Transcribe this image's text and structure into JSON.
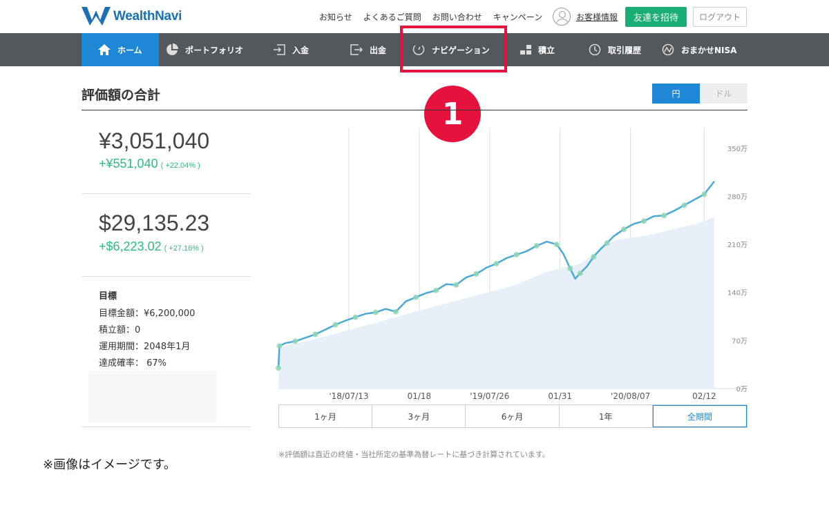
{
  "header": {
    "brand": "WealthNavi",
    "links": [
      "お知らせ",
      "よくあるご質問",
      "お問い合わせ",
      "キャンペーン"
    ],
    "account_label": "お客様情報",
    "invite_label": "友達を招待",
    "logout_label": "ログアウト"
  },
  "nav": {
    "items": [
      {
        "label": "ホーム",
        "icon": "home-icon",
        "active": true
      },
      {
        "label": "ポートフォリオ",
        "icon": "pie-chart-icon"
      },
      {
        "label": "入金",
        "icon": "deposit-icon"
      },
      {
        "label": "出金",
        "icon": "withdraw-icon"
      },
      {
        "label": "ナビゲーション",
        "icon": "gauge-icon"
      },
      {
        "label": "積立",
        "icon": "stack-icon"
      },
      {
        "label": "取引履歴",
        "icon": "history-icon"
      },
      {
        "label": "おまかせNISA",
        "icon": "nisa-icon"
      }
    ]
  },
  "annotation": {
    "step_number": "1",
    "highlight_color": "#e6123d"
  },
  "main": {
    "title": "評価額の合計",
    "currency_toggle": {
      "yen": "円",
      "dollar": "ドル",
      "selected": "円"
    },
    "summary": {
      "yen_total": "¥3,051,040",
      "yen_gain": "+¥551,040",
      "yen_gain_pct": "( +22.04% )",
      "usd_total": "$29,135.23",
      "usd_gain": "+$6,223.02",
      "usd_gain_pct": "( +27.16% )",
      "goal_heading": "目標",
      "goal_amount": "目標金額：¥6,200,000",
      "monthly": "積立額：0",
      "period": "運用期間：2048年1月",
      "probability": "達成確率：  67%"
    },
    "periods": [
      "1ヶ月",
      "3ヶ月",
      "6ヶ月",
      "1年",
      "全期間"
    ],
    "period_selected": "全期間",
    "note": "※評価額は直近の終値・当社所定の基準為替レートに基づき計算されています。"
  },
  "caption": "※画像はイメージです。",
  "colors": {
    "accent": "#1e87d6",
    "positive": "#2dbb7c",
    "nav_bg": "#53585c",
    "line": "#4aa8d8",
    "area": "#e7f0f9"
  },
  "chart_data": {
    "type": "line",
    "x_ticks": [
      "'18/07/13",
      "01/18",
      "'19/07/26",
      "01/31",
      "'20/08/07",
      "02/12"
    ],
    "y_ticks": [
      "0万",
      "70万",
      "140万",
      "210万",
      "280万",
      "350万"
    ],
    "ylim": [
      0,
      380
    ],
    "y_unit": "万円",
    "grid": true,
    "series": [
      {
        "role": "valuation",
        "x": [
          0,
          0.3,
          2,
          5,
          8,
          11,
          14,
          17,
          20,
          23,
          26,
          29,
          32,
          35,
          38,
          41,
          44,
          47,
          50,
          53,
          56,
          59,
          62,
          65,
          68,
          71,
          74,
          77,
          80,
          83,
          85,
          87,
          88.5,
          90,
          92,
          94,
          96,
          98,
          100,
          103,
          106,
          109,
          112,
          115,
          118,
          121,
          124,
          127,
          130
        ],
        "values": [
          30,
          62,
          66,
          69,
          74,
          79,
          86,
          93,
          99,
          104,
          109,
          111,
          116,
          112,
          127,
          133,
          139,
          143,
          152,
          151,
          162,
          167,
          176,
          182,
          190,
          195,
          200,
          208,
          214,
          210,
          196,
          175,
          160,
          168,
          178,
          192,
          203,
          212,
          222,
          232,
          240,
          244,
          251,
          252,
          259,
          267,
          275,
          283,
          302
        ]
      },
      {
        "role": "principal",
        "x": [
          0,
          0.3,
          10,
          20,
          30,
          40,
          50,
          60,
          70,
          80,
          90,
          100,
          110,
          120,
          125,
          130
        ],
        "values": [
          0,
          60,
          71,
          84,
          97,
          111,
          124,
          137,
          150,
          170,
          182,
          216,
          223,
          235,
          240,
          250
        ]
      }
    ]
  }
}
